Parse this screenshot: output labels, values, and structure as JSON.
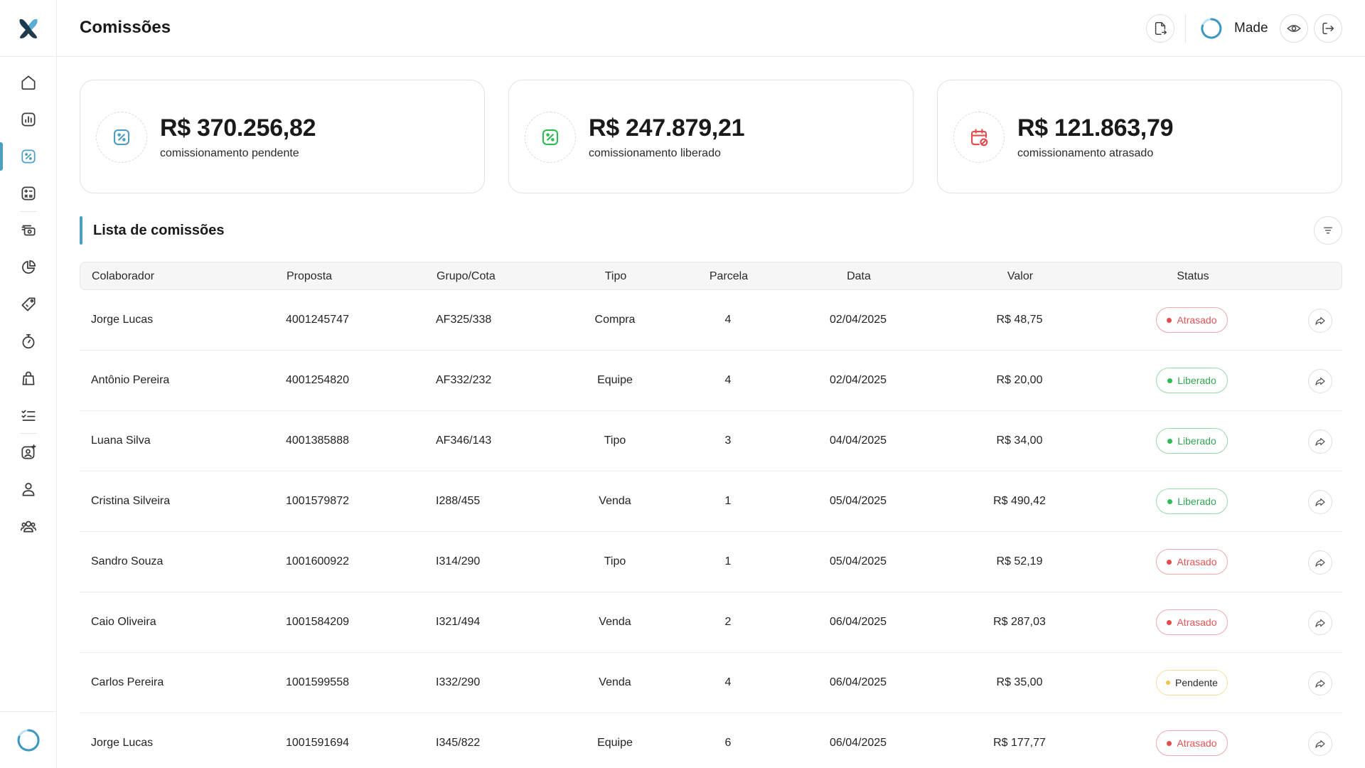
{
  "header": {
    "title": "Comissões",
    "user_name": "Made"
  },
  "colors": {
    "accent": "#4e9ec1",
    "late": "#e24c4c",
    "released": "#2fbb54",
    "pending": "#f2c24a"
  },
  "sidebar": {
    "items": [
      {
        "icon": "home-icon"
      },
      {
        "icon": "bar-chart-icon"
      },
      {
        "icon": "percent-icon",
        "active": true
      },
      {
        "icon": "calculator-icon"
      },
      {
        "icon": "cash-icon"
      },
      {
        "icon": "pie-chart-icon"
      },
      {
        "icon": "tag-icon"
      },
      {
        "icon": "stopwatch-icon"
      },
      {
        "icon": "bag-icon"
      },
      {
        "icon": "checklist-icon"
      },
      {
        "icon": "profile-sparkle-icon"
      },
      {
        "icon": "user-icon"
      },
      {
        "icon": "users-icon"
      }
    ]
  },
  "summary": [
    {
      "value": "R$ 370.256,82",
      "label": "comissionamento pendente",
      "icon": "percent-icon"
    },
    {
      "value": "R$ 247.879,21",
      "label": "comissionamento liberado",
      "icon": "percent-icon"
    },
    {
      "value": "R$ 121.863,79",
      "label": "comissionamento atrasado",
      "icon": "calendar-blocked-icon"
    }
  ],
  "section": {
    "title": "Lista de comissões"
  },
  "table": {
    "columns": [
      "Colaborador",
      "Proposta",
      "Grupo/Cota",
      "Tipo",
      "Parcela",
      "Data",
      "Valor",
      "Status"
    ],
    "rows": [
      {
        "colaborador": "Jorge Lucas",
        "proposta": "4001245747",
        "grupo": "AF325/338",
        "tipo": "Compra",
        "parcela": "4",
        "data": "02/04/2025",
        "valor": "R$ 48,75",
        "status": "Atrasado"
      },
      {
        "colaborador": "Antônio Pereira",
        "proposta": "4001254820",
        "grupo": "AF332/232",
        "tipo": "Equipe",
        "parcela": "4",
        "data": "02/04/2025",
        "valor": "R$ 20,00",
        "status": "Liberado"
      },
      {
        "colaborador": "Luana Silva",
        "proposta": "4001385888",
        "grupo": "AF346/143",
        "tipo": "Tipo",
        "parcela": "3",
        "data": "04/04/2025",
        "valor": "R$ 34,00",
        "status": "Liberado"
      },
      {
        "colaborador": "Cristina Silveira",
        "proposta": "1001579872",
        "grupo": "I288/455",
        "tipo": "Venda",
        "parcela": "1",
        "data": "05/04/2025",
        "valor": "R$ 490,42",
        "status": "Liberado"
      },
      {
        "colaborador": "Sandro Souza",
        "proposta": "1001600922",
        "grupo": "I314/290",
        "tipo": "Tipo",
        "parcela": "1",
        "data": "05/04/2025",
        "valor": "R$ 52,19",
        "status": "Atrasado"
      },
      {
        "colaborador": "Caio Oliveira",
        "proposta": "1001584209",
        "grupo": "I321/494",
        "tipo": "Venda",
        "parcela": "2",
        "data": "06/04/2025",
        "valor": "R$ 287,03",
        "status": "Atrasado"
      },
      {
        "colaborador": "Carlos Pereira",
        "proposta": "1001599558",
        "grupo": "I332/290",
        "tipo": "Venda",
        "parcela": "4",
        "data": "06/04/2025",
        "valor": "R$ 35,00",
        "status": "Pendente"
      },
      {
        "colaborador": "Jorge Lucas",
        "proposta": "1001591694",
        "grupo": "I345/822",
        "tipo": "Equipe",
        "parcela": "6",
        "data": "06/04/2025",
        "valor": "R$ 177,77",
        "status": "Atrasado"
      }
    ]
  }
}
